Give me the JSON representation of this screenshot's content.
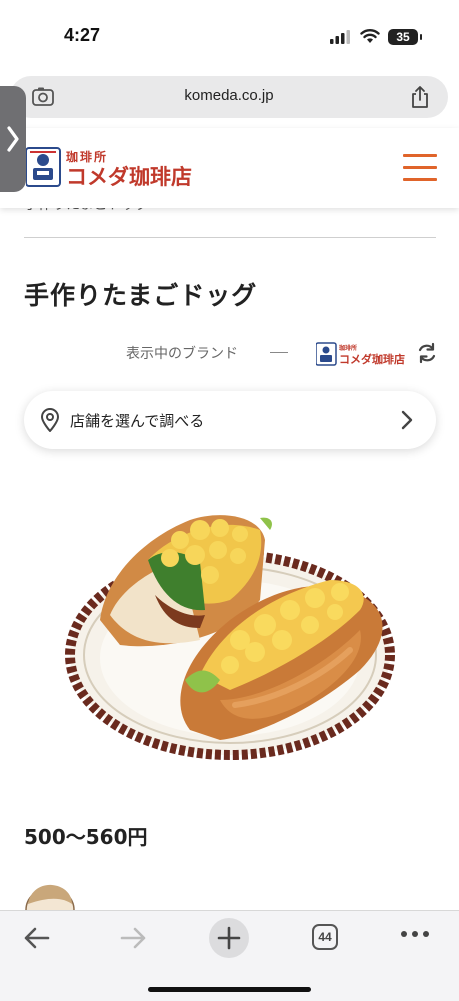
{
  "status": {
    "time": "4:27",
    "battery": "35"
  },
  "browser": {
    "url": "komeda.co.jp",
    "tab_count": "44"
  },
  "header": {
    "logo_text": "珈琲所 コメダ珈琲店",
    "brand_color": "#e0642a"
  },
  "breadcrumb": "手作りたまごドッグ",
  "page": {
    "title": "手作りたまごドッグ"
  },
  "brand": {
    "label": "表示中のブランド",
    "logo_text": "珈琲所 コメダ珈琲店"
  },
  "store_search": {
    "label": "店舗を選んで調べる"
  },
  "product": {
    "price": "500〜560円",
    "image": "egg-dog-sandwich-photo"
  }
}
